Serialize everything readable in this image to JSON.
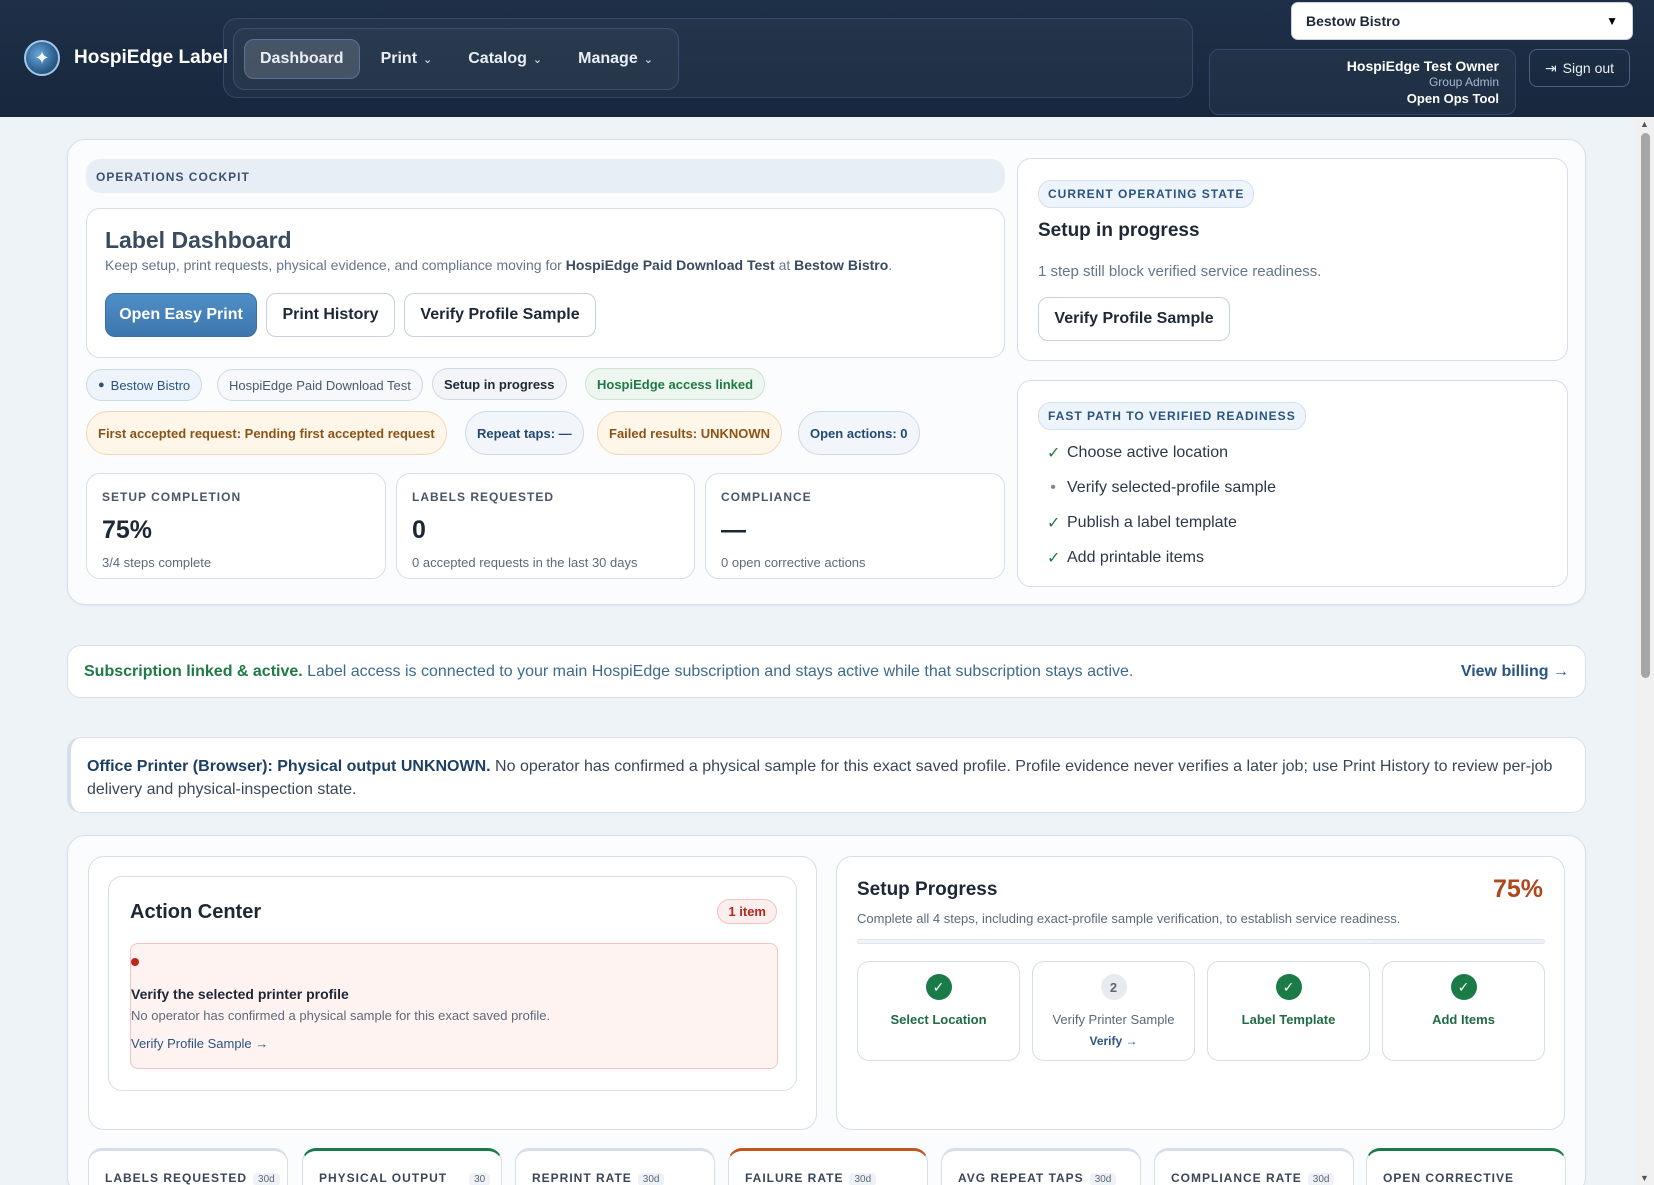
{
  "header": {
    "brand": "HospiEdge Label",
    "nav": [
      {
        "label": "Dashboard",
        "active": true,
        "dropdown": false
      },
      {
        "label": "Print",
        "active": false,
        "dropdown": true
      },
      {
        "label": "Catalog",
        "active": false,
        "dropdown": true
      },
      {
        "label": "Manage",
        "active": false,
        "dropdown": true
      }
    ],
    "location_select": "Bestow Bistro",
    "user": {
      "name": "HospiEdge Test Owner",
      "role": "Group Admin",
      "link": "Open Ops Tool"
    },
    "sign_out": "Sign out"
  },
  "cockpit": {
    "eyebrow": "OPERATIONS COCKPIT",
    "title": "Label Dashboard",
    "subtitle_prefix": "Keep setup, print requests, physical evidence, and compliance moving for ",
    "subtitle_org": "HospiEdge Paid Download Test",
    "subtitle_mid": " at ",
    "subtitle_loc": "Bestow Bistro",
    "subtitle_end": ".",
    "buttons": {
      "easy_print": "Open Easy Print",
      "history": "Print History",
      "verify": "Verify Profile Sample"
    },
    "pills_row1": {
      "location": "Bestow Bistro",
      "org": "HospiEdge Paid Download Test",
      "state": "Setup in progress",
      "access": "HospiEdge access linked"
    },
    "pills_row2": {
      "first": "First accepted request: Pending first accepted request",
      "repeat": "Repeat taps: —",
      "failed": "Failed results: UNKNOWN",
      "open": "Open actions: 0"
    },
    "stats": [
      {
        "label": "SETUP COMPLETION",
        "value": "75%",
        "foot": "3/4 steps complete"
      },
      {
        "label": "LABELS REQUESTED",
        "value": "0",
        "foot": "0 accepted requests in the last 30 days"
      },
      {
        "label": "COMPLIANCE",
        "value": "—",
        "foot": "0 open corrective actions"
      }
    ]
  },
  "operating_state": {
    "tag": "CURRENT OPERATING STATE",
    "title": "Setup in progress",
    "desc": "1 step still block verified service readiness.",
    "button": "Verify Profile Sample"
  },
  "fast_path": {
    "tag": "FAST PATH TO VERIFIED READINESS",
    "items": [
      {
        "label": "Choose active location",
        "done": true
      },
      {
        "label": "Verify selected-profile sample",
        "done": false
      },
      {
        "label": "Publish a label template",
        "done": true
      },
      {
        "label": "Add printable items",
        "done": true
      }
    ]
  },
  "subscription": {
    "strong": "Subscription linked & active.",
    "text": " Label access is connected to your main HospiEdge subscription and stays active while that subscription stays active.",
    "link": "View billing →"
  },
  "printer": {
    "strong": "Office Printer (Browser): Physical output UNKNOWN.",
    "text": " No operator has confirmed a physical sample for this exact saved profile. Profile evidence never verifies a later job; use Print History to review per-job delivery and physical-inspection state."
  },
  "action_center": {
    "title": "Action Center",
    "badge": "1 item",
    "item_title": "Verify the selected printer profile",
    "item_desc": "No operator has confirmed a physical sample for this exact saved profile.",
    "item_link": "Verify Profile Sample →"
  },
  "setup_progress": {
    "title": "Setup Progress",
    "percent_label": "75%",
    "percent": 0.75,
    "desc": "Complete all 4 steps, including exact-profile sample verification, to establish service readiness.",
    "steps": [
      {
        "label": "Select Location",
        "done": true,
        "marker": "✓"
      },
      {
        "label": "Verify Printer Sample",
        "done": false,
        "marker": "2",
        "link": "Verify →"
      },
      {
        "label": "Label Template",
        "done": true,
        "marker": "✓"
      },
      {
        "label": "Add Items",
        "done": true,
        "marker": "✓"
      }
    ]
  },
  "kpis": [
    {
      "label": "LABELS REQUESTED",
      "period": "30d",
      "accent": "#d5dee9"
    },
    {
      "label": "PHYSICAL OUTPUT",
      "period": "30",
      "accent": "#1a7a48"
    },
    {
      "label": "REPRINT RATE",
      "period": "30d",
      "accent": "#d5dee9"
    },
    {
      "label": "FAILURE RATE",
      "period": "30d",
      "accent": "#c0571c"
    },
    {
      "label": "AVG REPEAT TAPS",
      "period": "30d",
      "accent": "#d5dee9"
    },
    {
      "label": "COMPLIANCE RATE",
      "period": "30d",
      "accent": "#d5dee9"
    },
    {
      "label": "OPEN CORRECTIVE",
      "period": "",
      "accent": "#1a7a48"
    }
  ]
}
